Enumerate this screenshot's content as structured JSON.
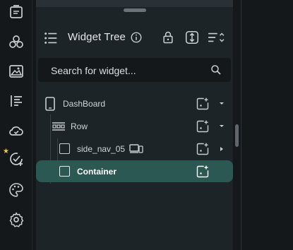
{
  "rail": {
    "items": [
      {
        "name": "pages-icon"
      },
      {
        "name": "components-icon"
      },
      {
        "name": "media-icon"
      },
      {
        "name": "widget-tree-icon"
      },
      {
        "name": "cloud-icon"
      },
      {
        "name": "new-feature-check-icon",
        "badge": "★"
      },
      {
        "name": "theme-icon"
      },
      {
        "name": "settings-icon"
      }
    ]
  },
  "panel": {
    "title": "Widget Tree",
    "search_placeholder": "Search for widget..."
  },
  "tree": {
    "items": [
      {
        "label": "DashBoard",
        "icon": "phone-icon",
        "expandable": true
      },
      {
        "label": "Row",
        "icon": "row-icon",
        "expandable": true
      },
      {
        "label": "side_nav_05",
        "icon": "checkbox-outline-icon",
        "extra_icon": "responsive-devices-icon",
        "expandable": true
      },
      {
        "label": "Container",
        "icon": "checkbox-outline-icon",
        "selected": true,
        "expandable": false
      }
    ]
  },
  "colors": {
    "background": "#14181b",
    "panel": "#1d2428",
    "selection": "#2b5852",
    "accent_star": "#f2c94c",
    "icon": "#c9ced2"
  }
}
